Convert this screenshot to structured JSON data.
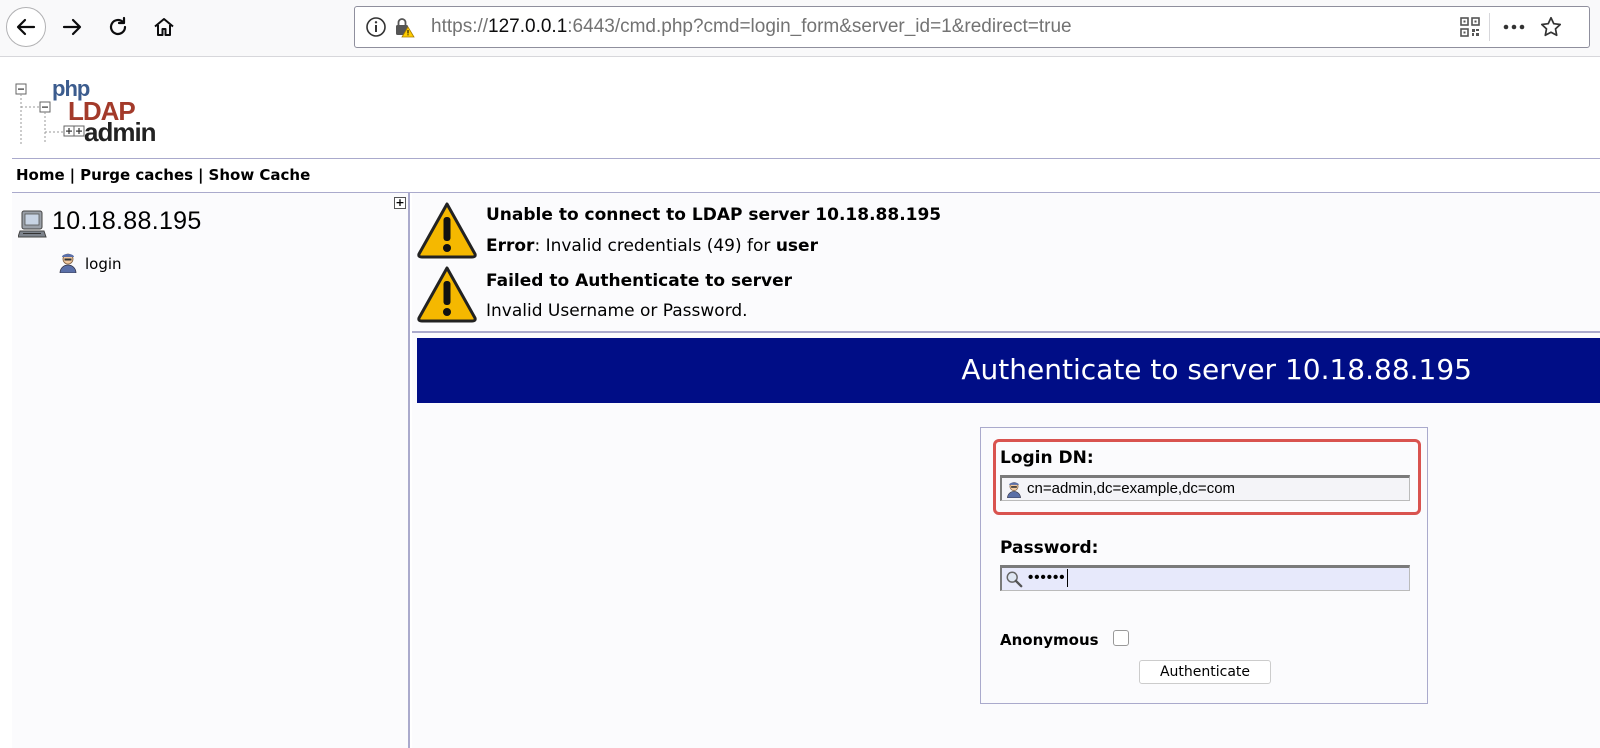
{
  "browser": {
    "url_prefix": "https://",
    "url_host": "127.0.0.1",
    "url_rest": ":6443/cmd.php?cmd=login_form&server_id=1&redirect=true"
  },
  "logo": {
    "php": "php",
    "ldap": "LDAP",
    "admin": "admin"
  },
  "menu": {
    "home": "Home",
    "purge": "Purge caches",
    "show_cache": "Show Cache",
    "separator": "|"
  },
  "tree": {
    "expand_symbol": "+",
    "server": "10.18.88.195",
    "login_link": "login"
  },
  "messages": [
    {
      "title": "Unable to connect to LDAP server 10.18.88.195",
      "body_label": "Error",
      "body_text": ": Invalid credentials (49) for ",
      "body_bold": "user"
    },
    {
      "title": "Failed to Authenticate to server",
      "body": "Invalid Username or Password."
    }
  ],
  "auth": {
    "banner_title": "Authenticate to server 10.18.88.195",
    "login_dn_label": "Login DN:",
    "login_dn_value": "cn=admin,dc=example,dc=com",
    "password_label": "Password:",
    "password_value": "••••••",
    "anonymous_label": "Anonymous",
    "anonymous_checked": false,
    "button_label": "Authenticate"
  },
  "colors": {
    "banner": "#000d86",
    "highlight": "#d9534f",
    "divider": "#aaaacc",
    "warning": "#f5b800"
  }
}
